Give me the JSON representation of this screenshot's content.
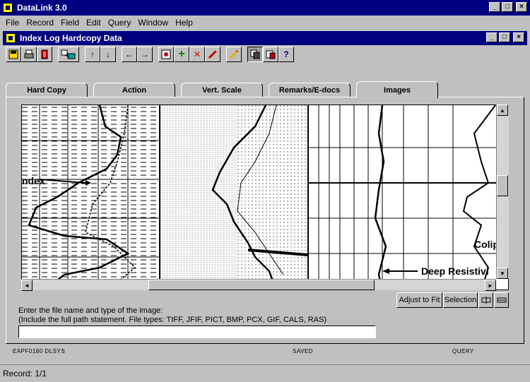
{
  "app": {
    "title": "DataLink 3.0"
  },
  "window_buttons": {
    "minimize": "_",
    "maximize": "□",
    "close": "×"
  },
  "menu": [
    {
      "label": "File"
    },
    {
      "label": "Record"
    },
    {
      "label": "Field"
    },
    {
      "label": "Edit"
    },
    {
      "label": "Query"
    },
    {
      "label": "Window"
    },
    {
      "label": "Help"
    }
  ],
  "child_window": {
    "title": "Index Log Hardcopy Data"
  },
  "toolbar": {
    "icons": [
      "save-icon",
      "print-icon",
      "exit-icon",
      "link-icon",
      "up-arrow-icon",
      "down-arrow-icon",
      "left-arrow-icon",
      "right-arrow-icon",
      "view-icon",
      "add-icon",
      "delete-icon",
      "edit-icon",
      "pencil-icon",
      "copy-icon",
      "paste-icon",
      "help-icon"
    ],
    "glyphs": {
      "up": "↑",
      "down": "↓",
      "left": "←",
      "right": "→",
      "add": "+",
      "delete": "✕",
      "help": "?"
    }
  },
  "tabs": [
    {
      "label": "Hard Copy"
    },
    {
      "label": "Action"
    },
    {
      "label": "Vert. Scale"
    },
    {
      "label": "Remarks/E-docs"
    },
    {
      "label": "Images"
    }
  ],
  "active_tab": "Images",
  "image_annotations": {
    "index": "ndex",
    "caliper": "Colip",
    "deep_resistivity": "Deep Resistivi"
  },
  "scroll_glyphs": {
    "up": "▲",
    "down": "▼",
    "left": "◄",
    "right": "►"
  },
  "buttons": {
    "adjust_to_fit": "Adjust to Fit",
    "selection": "Selection"
  },
  "instructions": {
    "line1": "Enter the file name and type of the image:",
    "line2": "(Include the full path statement.   File types:  TIFF, JFIF, PICT, BMP, PCX, GIF, CALS, RAS)"
  },
  "file_input": {
    "value": ""
  },
  "status": {
    "left": "EAPF0180  DLSYS",
    "center": "SAVED",
    "right": "QUERY"
  },
  "record": {
    "label": "Record: 1/1"
  },
  "colors": {
    "title_bar": "#000080",
    "face": "#c0c0c0",
    "viewer_bg": "#ffffff"
  }
}
